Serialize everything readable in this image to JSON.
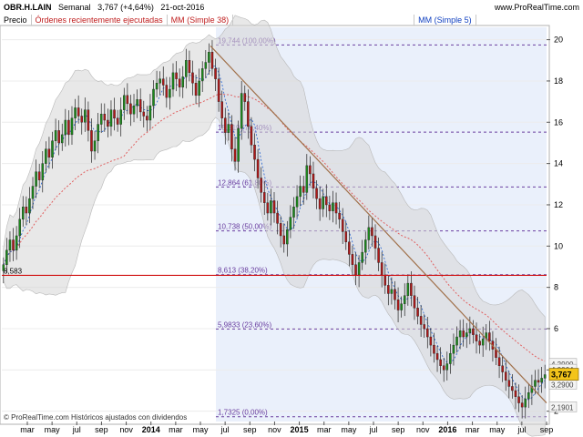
{
  "header": {
    "symbol": "OBR.H.LAIN",
    "period": "Semanal",
    "last": "3,767 (+4,64%)",
    "date": "21-oct-2016",
    "brand": "www.ProRealTime.com"
  },
  "legend": {
    "price": "Precio",
    "orders": "Órdenes recientemente ejecutadas",
    "ma38": "MM (Simple 38)",
    "ma5": "MM (Simple 5)"
  },
  "footer": "© ProRealTime.com Históricos ajustados con dividendos",
  "colors": {
    "up": "#1b8a1b",
    "down": "#b01818",
    "ma38": "#e06060",
    "ma5": "#2060d0",
    "fib": "#6a3fa0",
    "trendline": "#a0704a",
    "support": "#d01010",
    "shade": "#eaf0fb"
  },
  "chart_data": {
    "type": "candlestick",
    "x_ticks": [
      "mar",
      "may",
      "jul",
      "sep",
      "nov",
      "2014",
      "mar",
      "may",
      "jul",
      "sep",
      "nov",
      "2015",
      "mar",
      "may",
      "jul",
      "sep",
      "nov",
      "2016",
      "mar",
      "may",
      "jul",
      "sep"
    ],
    "y_ticks": [
      2,
      4,
      6,
      8,
      10,
      12,
      14,
      16,
      18,
      20
    ],
    "ylim": [
      1.5,
      20.6
    ],
    "last_price": "3,767",
    "price_labels": [
      "4,2900",
      "4,0064",
      "3,2900",
      "2,1901"
    ],
    "support_line": {
      "value": 8.583,
      "label": "8,583"
    },
    "fibonacci_levels": [
      {
        "value": 19.744,
        "label": "19,744 (100,00%)"
      },
      {
        "value": 15.519,
        "label": "15,519 (76,40%)"
      },
      {
        "value": 12.864,
        "label": "12,864 (61,80%)"
      },
      {
        "value": 10.738,
        "label": "10,738 (50,00%)"
      },
      {
        "value": 8.613,
        "label": "8,613 (38,20%)"
      },
      {
        "value": 5.9833,
        "label": "5,9833 (23,60%)"
      },
      {
        "value": 1.7325,
        "label": "1,7325 (0,00%)"
      }
    ],
    "closes": [
      9.1,
      9.8,
      10.3,
      9.8,
      10.5,
      11.3,
      11.9,
      11.6,
      12.3,
      12.9,
      13.6,
      13.2,
      14.0,
      14.7,
      14.3,
      15.1,
      15.6,
      15.0,
      15.4,
      16.1,
      15.4,
      16.2,
      16.7,
      16.3,
      16.0,
      16.6,
      15.6,
      14.6,
      15.1,
      15.9,
      16.4,
      16.1,
      15.8,
      16.6,
      16.2,
      15.9,
      16.6,
      17.3,
      16.9,
      16.4,
      16.8,
      17.1,
      16.5,
      16.3,
      16.1,
      16.8,
      17.6,
      17.9,
      18.1,
      17.8,
      17.2,
      17.6,
      18.4,
      18.1,
      17.7,
      18.2,
      19.0,
      18.4,
      17.9,
      17.3,
      18.0,
      18.6,
      18.9,
      19.4,
      18.6,
      18.1,
      17.0,
      16.2,
      15.5,
      15.9,
      14.7,
      14.1,
      15.7,
      17.4,
      17.0,
      15.8,
      14.9,
      14.2,
      13.3,
      12.6,
      12.1,
      11.6,
      12.2,
      11.6,
      11.1,
      10.5,
      10.1,
      10.8,
      11.4,
      11.9,
      12.4,
      12.9,
      12.6,
      13.9,
      13.5,
      12.8,
      12.3,
      11.8,
      12.4,
      12.0,
      11.7,
      12.1,
      11.6,
      11.3,
      10.7,
      10.2,
      9.6,
      9.1,
      8.6,
      9.2,
      9.7,
      10.3,
      10.9,
      10.5,
      9.9,
      9.2,
      8.6,
      8.1,
      7.7,
      7.9,
      7.4,
      6.9,
      7.2,
      7.6,
      8.2,
      7.6,
      7.0,
      6.6,
      6.2,
      6.0,
      5.6,
      5.2,
      4.8,
      4.5,
      4.2,
      4.0,
      4.3,
      4.8,
      5.2,
      5.6,
      5.9,
      5.6,
      5.8,
      6.0,
      5.7,
      5.4,
      5.2,
      5.5,
      5.8,
      5.4,
      5.0,
      4.6,
      4.2,
      3.9,
      3.5,
      3.2,
      3.0,
      2.7,
      2.4,
      2.2,
      2.6,
      2.9,
      3.2,
      3.5,
      3.4,
      3.6,
      3.77
    ]
  }
}
